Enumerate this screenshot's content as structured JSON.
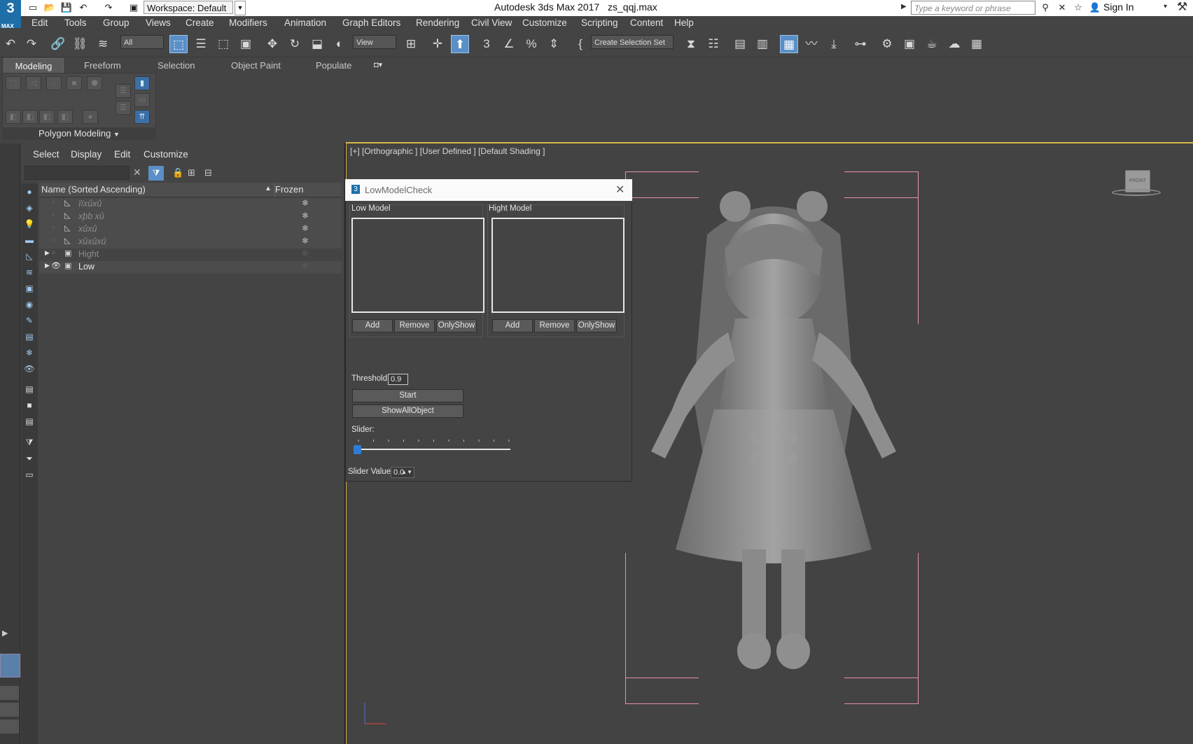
{
  "titlebar": {
    "logo": "3",
    "logo_sub": "MAX",
    "workspace": "Workspace: Default",
    "app_title": "Autodesk 3ds Max 2017",
    "file_title": "zs_qqj.max",
    "search_placeholder": "Type a keyword or phrase",
    "sign_in": "Sign In"
  },
  "menubar": [
    "Edit",
    "Tools",
    "Group",
    "Views",
    "Create",
    "Modifiers",
    "Animation",
    "Graph Editors",
    "Rendering",
    "Civil View",
    "Customize",
    "Scripting",
    "Content",
    "Help"
  ],
  "toolbar": {
    "filter_value": "All",
    "view_value": "View",
    "selection_set": "Create Selection Set"
  },
  "ribbon": {
    "tabs": [
      "Modeling",
      "Freeform",
      "Selection",
      "Object Paint",
      "Populate"
    ],
    "panel_label": "Polygon Modeling"
  },
  "scene_explorer": {
    "menu": [
      "Select",
      "Display",
      "Edit",
      "Customize"
    ],
    "col_name": "Name (Sorted Ascending)",
    "col_frozen": "Frozen",
    "rows": [
      {
        "name": "ïïxûxû"
      },
      {
        "name": "xþb xû"
      },
      {
        "name": "xûxû"
      },
      {
        "name": "xûxûxû"
      },
      {
        "name": "Hight"
      },
      {
        "name": "Low"
      }
    ]
  },
  "viewport": {
    "label": "[+] [Orthographic ] [User Defined ] [Default Shading ]",
    "viewcube": "FRONT"
  },
  "dialog": {
    "title": "LowModelCheck",
    "low_group": "Low Model",
    "high_group": "Hight Model",
    "add": "Add",
    "remove": "Remove",
    "only_show": "OnlyShow",
    "threshold_label": "Threshold",
    "threshold_value": "0.9",
    "start": "Start",
    "show_all": "ShowAllObject",
    "slider_label": "Slider:",
    "slider_value_label": "Slider Value:",
    "slider_value": "0.0",
    "slider_level": 0.0
  }
}
